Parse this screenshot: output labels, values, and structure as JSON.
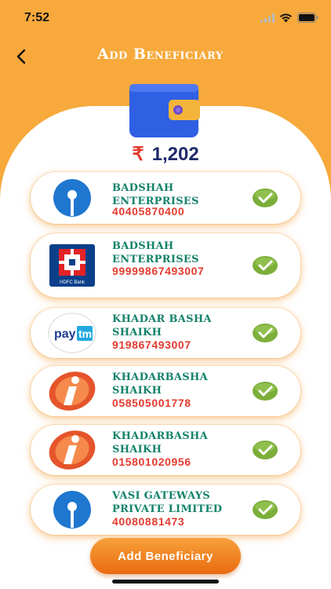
{
  "status": {
    "time": "7:52"
  },
  "header": {
    "title": "Add Beneficiary"
  },
  "wallet": {
    "currency_symbol": "₹",
    "balance": "1,202"
  },
  "beneficiaries": [
    {
      "name": "BADSHAH ENTERPRISES",
      "account": "40405870400",
      "bank_icon": "sbi-icon",
      "verified": true
    },
    {
      "name": "BADSHAH ENTERPRISES",
      "account": "99999867493007",
      "bank_icon": "hdfc-bank-icon",
      "bank_label": "HDFC Bank",
      "verified": true
    },
    {
      "name": "KHADAR BASHA SHAIKH",
      "account": "919867493007",
      "bank_icon": "paytm-icon",
      "bank_label": "paytm",
      "verified": true
    },
    {
      "name": "KHADARBASHA SHAIKH",
      "account": "058505001778",
      "bank_icon": "icici-icon",
      "verified": true
    },
    {
      "name": "KHADARBASHA SHAIKH",
      "account": "015801020956",
      "bank_icon": "icici-icon",
      "verified": true
    },
    {
      "name": "VASI GATEWAYS PRIVATE LIMITED",
      "account": "40080881473",
      "bank_icon": "sbi-icon",
      "verified": true
    }
  ],
  "actions": {
    "add_label": "Add Beneficiary"
  },
  "colors": {
    "accent": "#f7a93b",
    "name_text": "#14826a",
    "account_text": "#e23b2f",
    "balance_text": "#1f2a6b",
    "check": "#7cae3a"
  }
}
